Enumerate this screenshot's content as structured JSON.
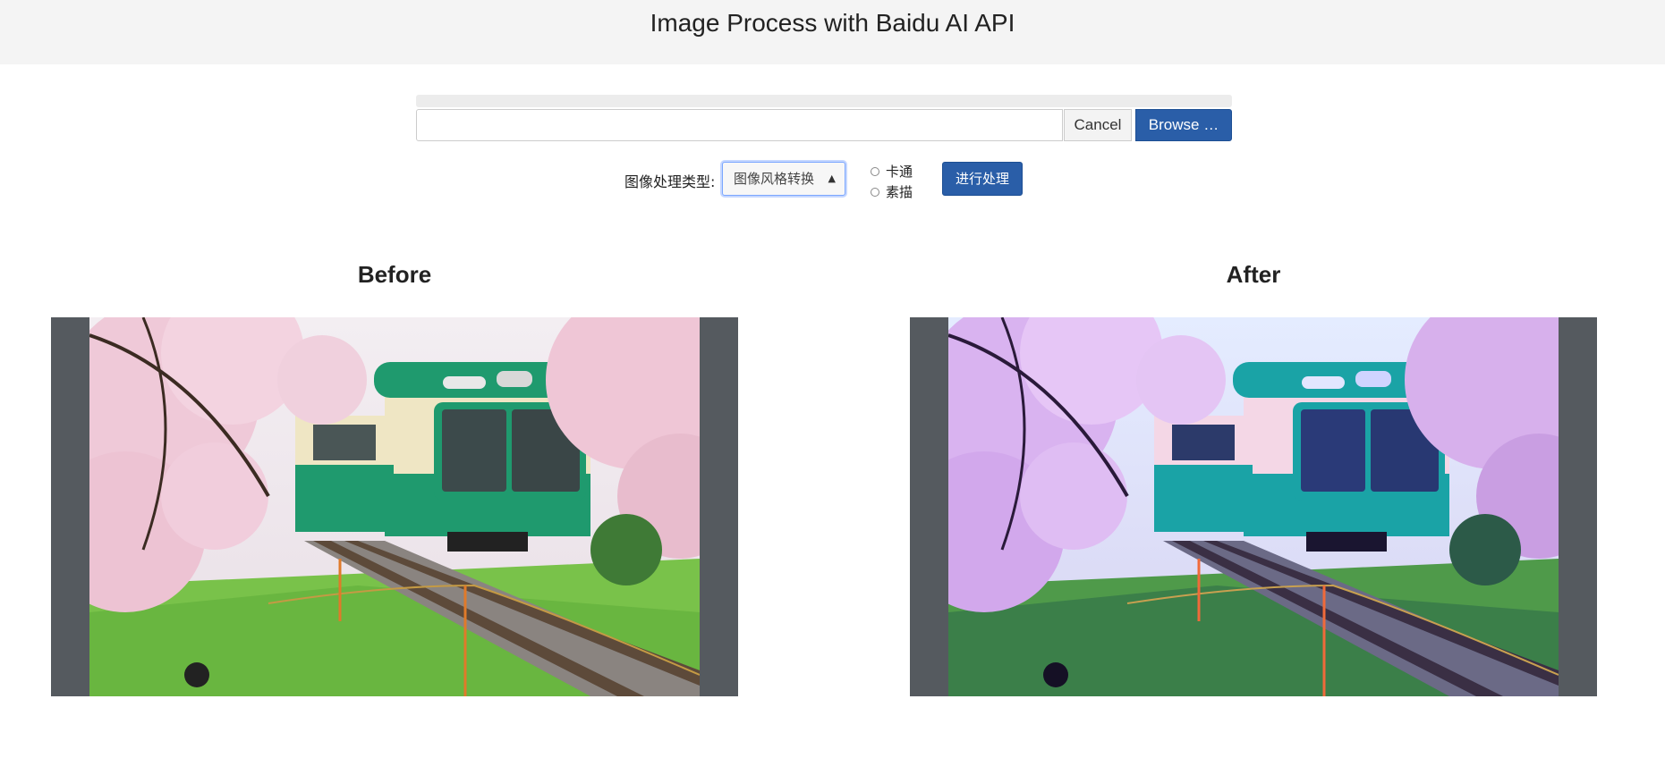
{
  "header": {
    "title": "Image Process with Baidu AI API"
  },
  "upload": {
    "file_value": "",
    "cancel_label": "Cancel",
    "browse_label": "Browse …"
  },
  "controls": {
    "type_label": "图像处理类型:",
    "select_value": "图像风格转换",
    "radio_options": [
      "卡通",
      "素描"
    ],
    "process_label": "进行处理"
  },
  "panels": {
    "before_title": "Before",
    "after_title": "After"
  },
  "colors": {
    "accent": "#2a5ea8",
    "header_bg": "#f4f4f4",
    "frame_bg": "#555a5f"
  }
}
